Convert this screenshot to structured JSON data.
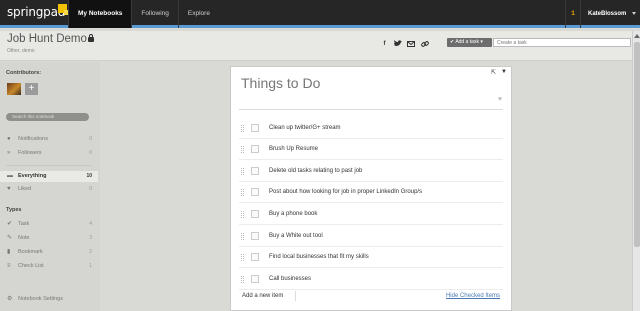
{
  "app": {
    "logo_text": "springpad"
  },
  "topnav": {
    "items": [
      {
        "label": "My Notebooks",
        "active": true
      },
      {
        "label": "Following",
        "active": false
      },
      {
        "label": "Explore",
        "active": false
      }
    ],
    "notification_count": "1",
    "username": "KateBlossom"
  },
  "notebook": {
    "title": "Job Hunt Demo",
    "subtitle": "Other, demo",
    "share_icons": [
      "facebook-icon",
      "twitter-icon",
      "email-icon",
      "link-icon"
    ],
    "add_button_label": "Add a task",
    "add_input_placeholder": "Create a task"
  },
  "sidebar": {
    "contributors_label": "Contributors:",
    "add_contributor_label": "+",
    "search_placeholder": "Search this notebook",
    "activity": [
      {
        "label": "Notifications",
        "count": "0",
        "icon": "alert-icon"
      },
      {
        "label": "Followers",
        "count": "0",
        "icon": "followers-icon"
      }
    ],
    "filters": [
      {
        "label": "Everything",
        "count": "10",
        "icon": "everything-icon",
        "selected": true
      },
      {
        "label": "Liked",
        "count": "0",
        "icon": "heart-icon",
        "selected": false
      }
    ],
    "types_label": "Types",
    "types": [
      {
        "label": "Task",
        "count": "4",
        "icon": "task-check-icon"
      },
      {
        "label": "Note",
        "count": "3",
        "icon": "note-pencil-icon"
      },
      {
        "label": "Bookmark",
        "count": "2",
        "icon": "bookmark-icon"
      },
      {
        "label": "Check List",
        "count": "1",
        "icon": "checklist-icon"
      }
    ],
    "settings_label": "Notebook Settings"
  },
  "panel": {
    "title": "Things to Do",
    "items": [
      "Clean up twitter/G+ stream",
      "Brush Up Resume",
      "Delete old tasks relating to past job",
      "Post about how looking for job in proper LinkedIn Group/s",
      "Buy a phone book",
      "Buy a White out tool",
      "Find local businesses that fit my skills",
      "Call businesses"
    ],
    "add_item_label": "Add a new item",
    "hide_checked_label": "Hide Checked Items"
  },
  "colors": {
    "topbar": "#262626",
    "accent_stripe": "#5a9bd5",
    "notification": "#f2a900",
    "link": "#4a78b5"
  }
}
